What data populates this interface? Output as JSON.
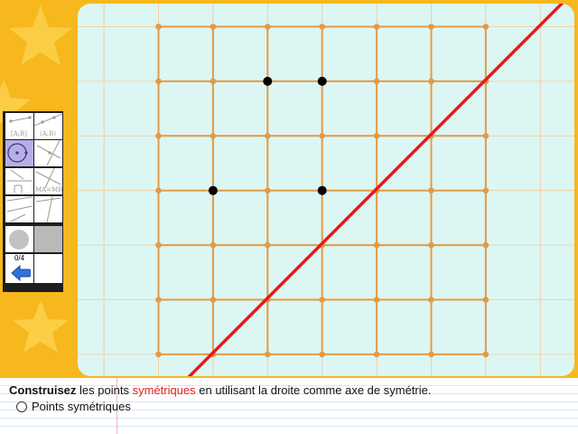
{
  "colors": {
    "background": "#f6b81c",
    "canvas": "#dcf6f3",
    "grid_fine": "#f2c89a",
    "grid_main": "#e39a45",
    "grid_dots": "#e39a45",
    "axis": "#e51b1b",
    "points": "#000000"
  },
  "grid": {
    "columns": 6,
    "rows": 6
  },
  "points": [
    {
      "col": 2,
      "row": 1
    },
    {
      "col": 3,
      "row": 1
    },
    {
      "col": 1,
      "row": 3
    },
    {
      "col": 3,
      "row": 3
    }
  ],
  "axis_of_symmetry": {
    "description": "diagonal line",
    "direction": "bottom-left to top-right"
  },
  "toolbar": {
    "tools": [
      {
        "icon": "segment-icon",
        "label": "[A;B]"
      },
      {
        "icon": "line-icon",
        "label": "(A;B)"
      },
      {
        "icon": "circle-icon",
        "label": ""
      },
      {
        "icon": "ray-icon",
        "label": ""
      },
      {
        "icon": "perpendicular-icon",
        "label": ""
      },
      {
        "icon": "equal-length-icon",
        "label": "MA=MB"
      },
      {
        "icon": "compass-icon",
        "label": ""
      },
      {
        "icon": "ruler-icon",
        "label": ""
      },
      {
        "icon": "color-disc-icon",
        "label": ""
      },
      {
        "icon": "grey-square-icon",
        "label": ""
      }
    ],
    "score": "0/4",
    "back_icon": "back-arrow-icon"
  },
  "instructions": {
    "bold": "Construisez",
    "part1": " les points ",
    "highlight": "symétriques",
    "part2": " en utilisant la droite comme axe de symétrie."
  },
  "option": {
    "label": "Points symétriques"
  }
}
